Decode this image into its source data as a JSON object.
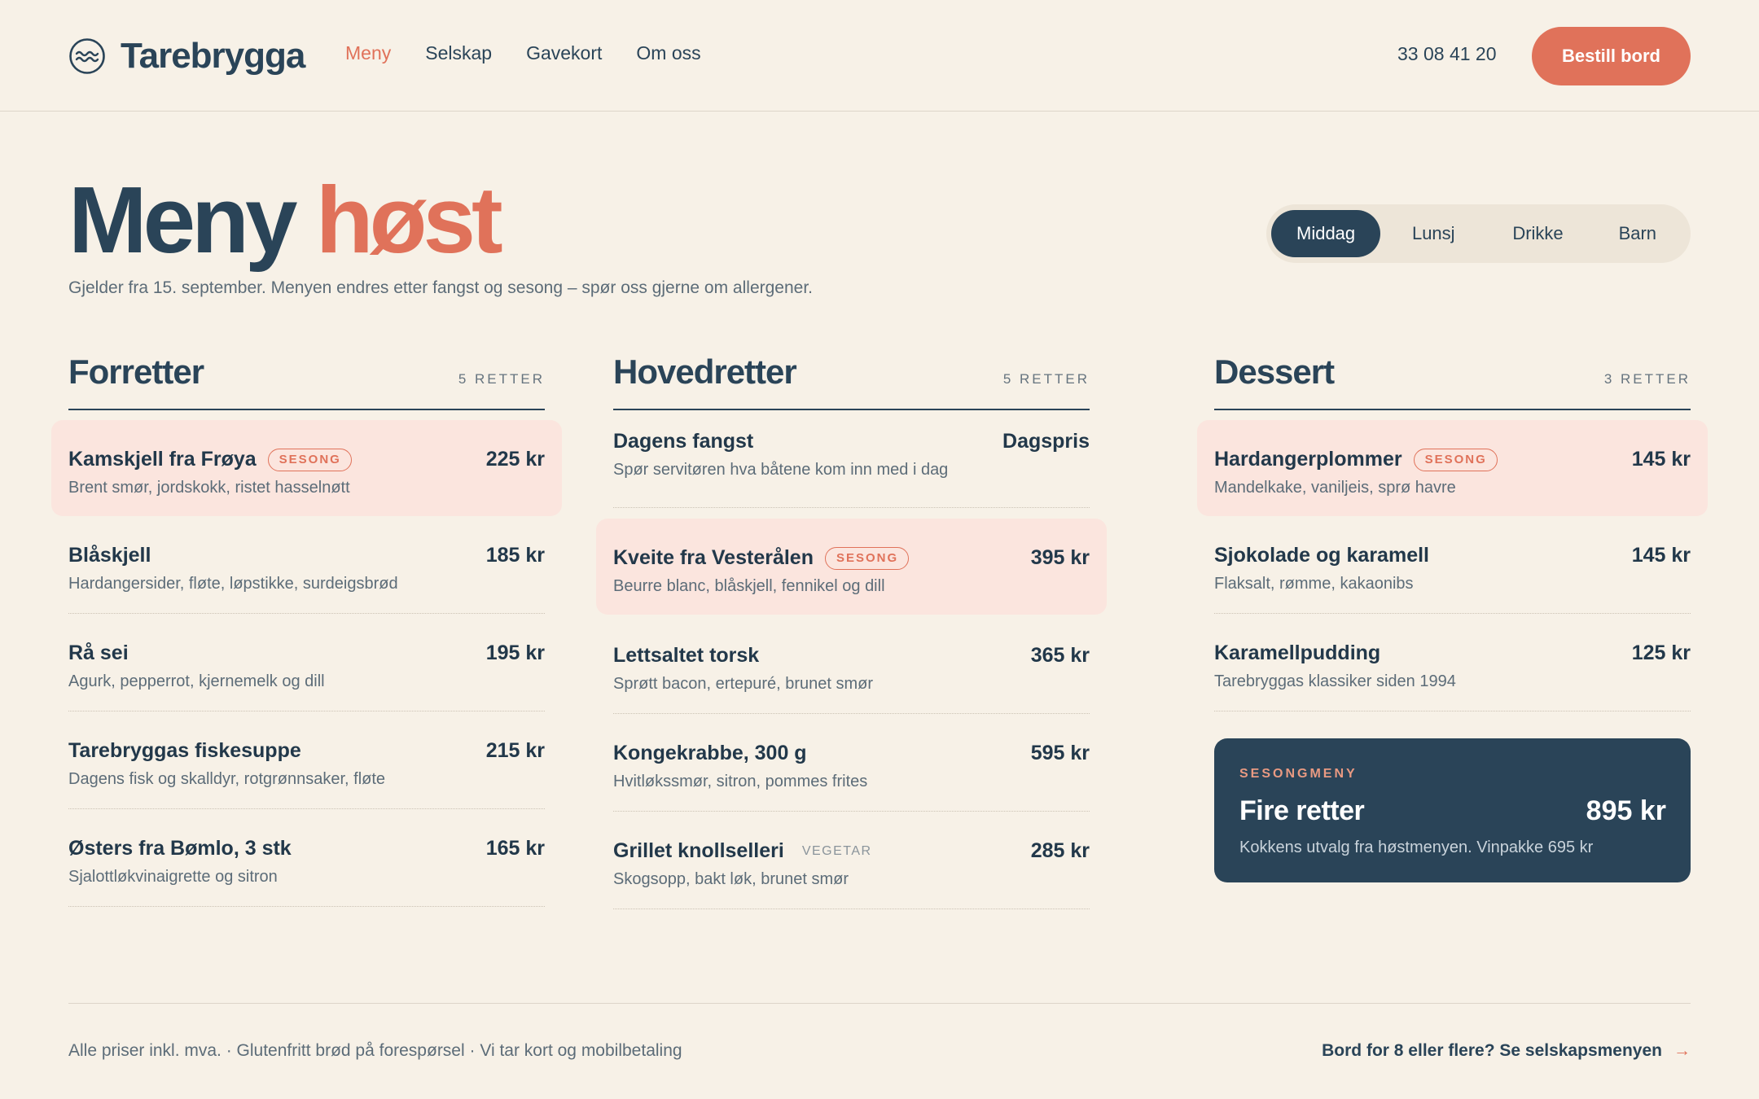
{
  "header": {
    "brand": "Tarebrygga",
    "nav": [
      "Meny",
      "Selskap",
      "Gavekort",
      "Om oss"
    ],
    "phone": "33 08 41 20",
    "cta": "Bestill bord"
  },
  "hero": {
    "title_part1": "Meny",
    "title_part2": "høst",
    "subtitle": "Gjelder fra 15. september. Menyen endres etter fangst og sesong – spør oss gjerne om allergener.",
    "tabs": [
      "Middag",
      "Lunsj",
      "Drikke",
      "Barn"
    ],
    "active_tab": "Middag"
  },
  "sections": [
    {
      "title": "Forretter",
      "count": "5 RETTER",
      "items": [
        {
          "name": "Kamskjell fra Frøya",
          "badge": "SESONG",
          "desc": "Brent smør, jordskokk, ristet hasselnøtt",
          "price": "225 kr"
        },
        {
          "name": "Blåskjell",
          "desc": "Hardangersider, fløte, løpstikke, surdeigsbrød",
          "price": "185 kr"
        },
        {
          "name": "Rå sei",
          "desc": "Agurk, pepperrot, kjernemelk og dill",
          "price": "195 kr"
        },
        {
          "name": "Tarebryggas fiskesuppe",
          "desc": "Dagens fisk og skalldyr, rotgrønnsaker, fløte",
          "price": "215 kr"
        },
        {
          "name": "Østers fra Bømlo, 3 stk",
          "desc": "Sjalottløkvinaigrette og sitron",
          "price": "165 kr"
        }
      ]
    },
    {
      "title": "Hovedretter",
      "count": "5 RETTER",
      "items": [
        {
          "name": "Dagens fangst",
          "desc": "Spør servitøren hva båtene kom inn med i dag",
          "price": "Dagspris"
        },
        {
          "name": "Kveite fra Vesterålen",
          "badge": "SESONG",
          "desc": "Beurre blanc, blåskjell, fennikel og dill",
          "price": "395 kr"
        },
        {
          "name": "Lettsaltet torsk",
          "desc": "Sprøtt bacon, ertepuré, brunet smør",
          "price": "365 kr"
        },
        {
          "name": "Kongekrabbe, 300 g",
          "desc": "Hvitløkssmør, sitron, pommes frites",
          "price": "595 kr"
        },
        {
          "name": "Grillet knollselleri",
          "tag": "VEGETAR",
          "desc": "Skogsopp, bakt løk, brunet smør",
          "price": "285 kr"
        }
      ]
    },
    {
      "title": "Dessert",
      "count": "3 RETTER",
      "items": [
        {
          "name": "Hardangerplommer",
          "badge": "SESONG",
          "desc": "Mandelkake, vaniljeis, sprø havre",
          "price": "145 kr"
        },
        {
          "name": "Sjokolade og karamell",
          "desc": "Flaksalt, rømme, kakaonibs",
          "price": "145 kr"
        },
        {
          "name": "Karamellpudding",
          "desc": "Tarebryggas klassiker siden 1994",
          "price": "125 kr"
        }
      ]
    }
  ],
  "set_menu": {
    "eyebrow": "SESONGMENY",
    "title": "Fire retter",
    "price": "895 kr",
    "desc": "Kokkens utvalg fra høstmenyen. Vinpakke 695 kr"
  },
  "footer": {
    "note": "Alle priser inkl. mva. · Glutenfritt brød på forespørsel · Vi tar kort og mobilbetaling",
    "link": "Bord for 8 eller flere? Se selskapsmenyen",
    "arrow": "→"
  },
  "colors": {
    "background": "#f7f1e7",
    "navy": "#2a4458",
    "accent": "#e0725a",
    "highlight": "#fbe5de"
  },
  "icons": {
    "logo": "waves-icon",
    "footer_arrow": "arrow-right-icon"
  }
}
